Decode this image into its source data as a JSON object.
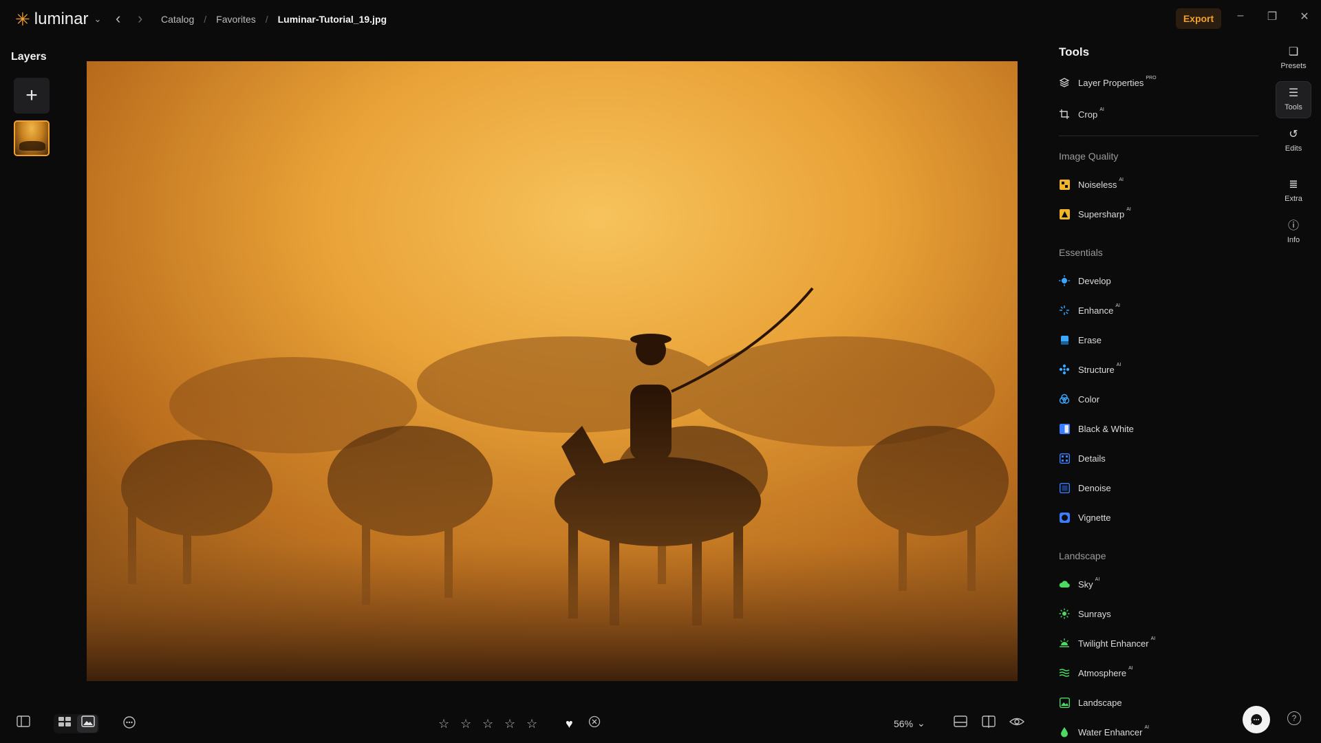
{
  "app": {
    "name": "luminar"
  },
  "breadcrumb": {
    "items": [
      "Catalog",
      "Favorites"
    ],
    "current": "Luminar-Tutorial_19.jpg"
  },
  "header": {
    "export_label": "Export"
  },
  "layers": {
    "title": "Layers",
    "add_label": "+"
  },
  "tools": {
    "title": "Tools",
    "top_items": [
      {
        "label": "Layer Properties",
        "badge": "PRO",
        "icon": "layers-icon"
      },
      {
        "label": "Crop",
        "badge": "AI",
        "icon": "crop-icon"
      }
    ],
    "sections": [
      {
        "title": "Image Quality",
        "items": [
          {
            "label": "Noiseless",
            "badge": "AI",
            "icon": "noiseless-icon",
            "color": "#f0b429"
          },
          {
            "label": "Supersharp",
            "badge": "AI",
            "icon": "supersharp-icon",
            "color": "#f0b429"
          }
        ]
      },
      {
        "title": "Essentials",
        "items": [
          {
            "label": "Develop",
            "badge": "",
            "icon": "develop-icon",
            "color": "#3aa8ff"
          },
          {
            "label": "Enhance",
            "badge": "AI",
            "icon": "enhance-icon",
            "color": "#3aa8ff"
          },
          {
            "label": "Erase",
            "badge": "",
            "icon": "erase-icon",
            "color": "#3aa8ff"
          },
          {
            "label": "Structure",
            "badge": "AI",
            "icon": "structure-icon",
            "color": "#3aa8ff"
          },
          {
            "label": "Color",
            "badge": "",
            "icon": "color-icon",
            "color": "#3aa8ff"
          },
          {
            "label": "Black & White",
            "badge": "",
            "icon": "black-white-icon",
            "color": "#3a7dff"
          },
          {
            "label": "Details",
            "badge": "",
            "icon": "details-icon",
            "color": "#3a7dff"
          },
          {
            "label": "Denoise",
            "badge": "",
            "icon": "denoise-icon",
            "color": "#3a7dff"
          },
          {
            "label": "Vignette",
            "badge": "",
            "icon": "vignette-icon",
            "color": "#3a7dff"
          }
        ]
      },
      {
        "title": "Landscape",
        "items": [
          {
            "label": "Sky",
            "badge": "AI",
            "icon": "sky-icon",
            "color": "#4cd964"
          },
          {
            "label": "Sunrays",
            "badge": "",
            "icon": "sunrays-icon",
            "color": "#4cd964"
          },
          {
            "label": "Twilight Enhancer",
            "badge": "AI",
            "icon": "twilight-icon",
            "color": "#4cd964"
          },
          {
            "label": "Atmosphere",
            "badge": "AI",
            "icon": "atmosphere-icon",
            "color": "#4cd964"
          },
          {
            "label": "Landscape",
            "badge": "",
            "icon": "landscape-icon",
            "color": "#4cd964"
          },
          {
            "label": "Water Enhancer",
            "badge": "AI",
            "icon": "water-icon",
            "color": "#4cd964"
          }
        ]
      }
    ]
  },
  "rail": [
    {
      "label": "Presets",
      "icon": "presets-icon",
      "active": false
    },
    {
      "label": "Tools",
      "icon": "tools-icon",
      "active": true
    },
    {
      "label": "Edits",
      "icon": "edits-icon",
      "active": false
    },
    {
      "label": "Extra",
      "icon": "extra-icon",
      "active": false
    },
    {
      "label": "Info",
      "icon": "info-icon",
      "active": false
    }
  ],
  "bottombar": {
    "rating_stars": 5,
    "rating": 0,
    "favorite": true,
    "zoom": "56%"
  },
  "colors": {
    "accent": "#f3a12a",
    "background": "#0b0b0c"
  }
}
